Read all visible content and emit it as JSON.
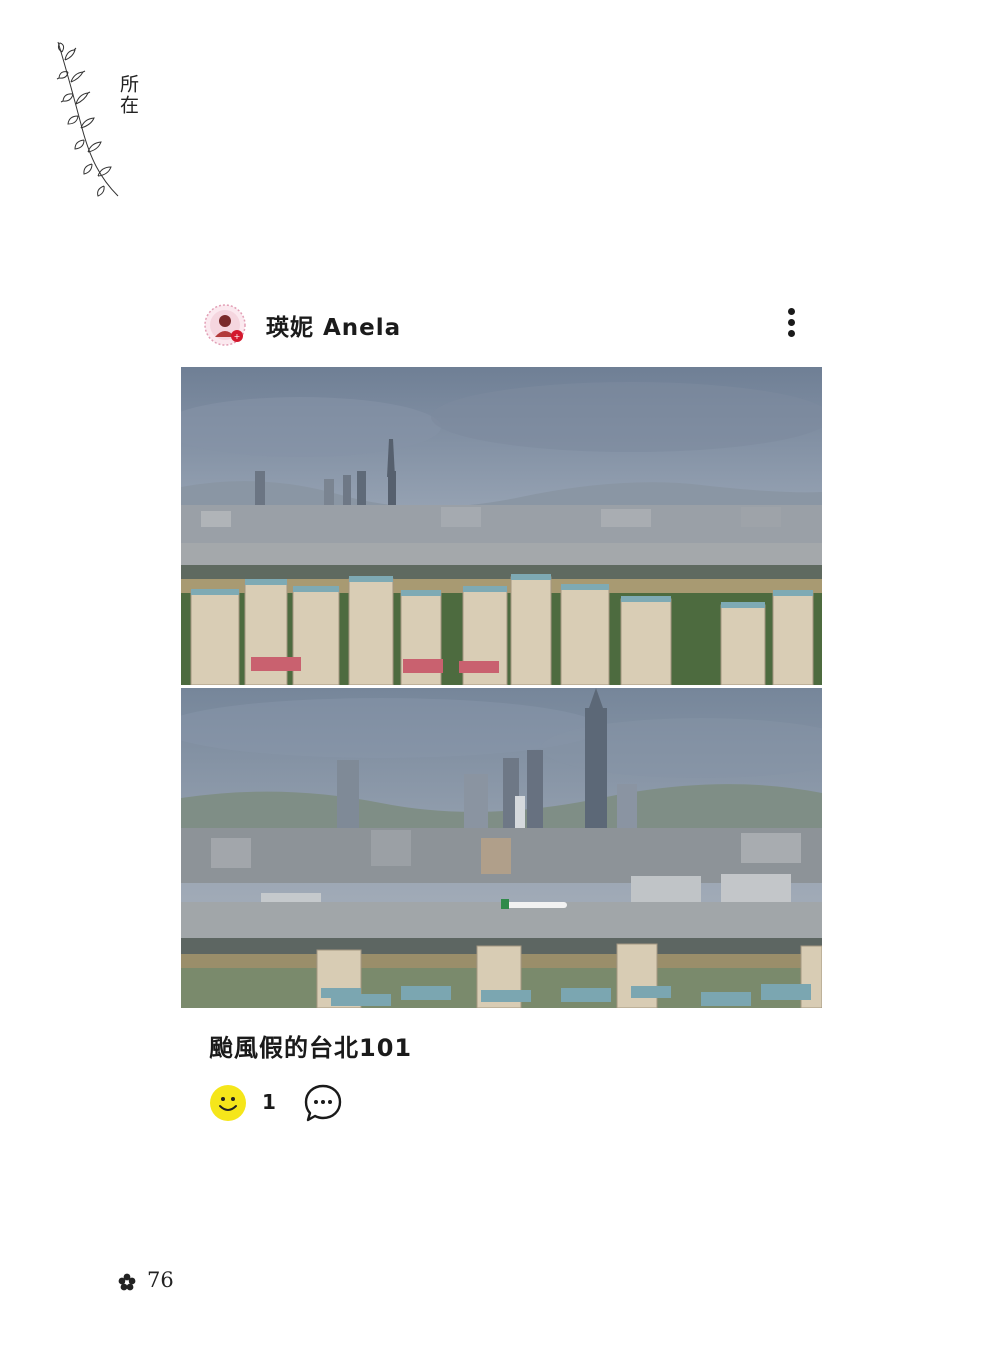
{
  "chapter": {
    "title": "所在",
    "vine_icon": "vine-ornament-icon"
  },
  "post": {
    "author_name": "瑛妮 Anela",
    "avatar_icon": "profile-avatar",
    "more_icon": "more-options-icon",
    "photos": [
      {
        "alt": "Taipei skyline with Taipei 101 behind residential blocks under cloudy sky"
      },
      {
        "alt": "Zoomed view of Taipei 101 and skyline with airplane on runway"
      }
    ],
    "caption": "颱風假的台北101",
    "reactions": {
      "reaction_icon": "smiley-icon",
      "count": "1",
      "comment_icon": "comment-icon"
    }
  },
  "footer": {
    "icon": "flower-icon",
    "page_number": "76"
  },
  "colors": {
    "reaction_yellow": "#f5e61a",
    "text": "#1a1a1a"
  }
}
